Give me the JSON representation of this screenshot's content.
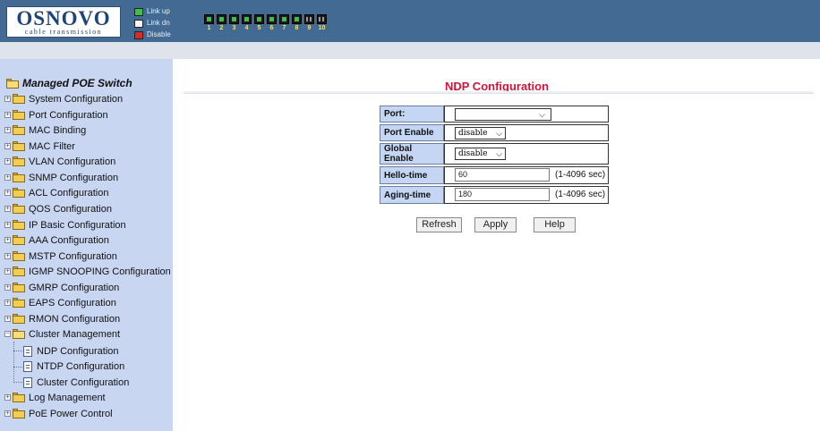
{
  "header": {
    "brand": "OSNOVO",
    "tagline": "cable transmission",
    "legend": [
      {
        "label": "Link up",
        "color": "#3ac14a"
      },
      {
        "label": "Link dn",
        "color": "#f5f5f5"
      },
      {
        "label": "Disable",
        "color": "#d92a2a"
      }
    ],
    "ports": [
      "1",
      "2",
      "3",
      "4",
      "5",
      "6",
      "7",
      "8",
      "9",
      "10"
    ]
  },
  "sidebar": {
    "title": "Managed POE Switch",
    "items": [
      {
        "label": "System Configuration"
      },
      {
        "label": "Port Configuration"
      },
      {
        "label": "MAC Binding"
      },
      {
        "label": "MAC Filter"
      },
      {
        "label": "VLAN Configuration"
      },
      {
        "label": "SNMP Configuration"
      },
      {
        "label": "ACL Configuration"
      },
      {
        "label": "QOS Configuration"
      },
      {
        "label": "IP Basic Configuration"
      },
      {
        "label": "AAA Configuration"
      },
      {
        "label": "MSTP Configuration"
      },
      {
        "label": "IGMP SNOOPING Configuration"
      },
      {
        "label": "GMRP Configuration"
      },
      {
        "label": "EAPS Configuration"
      },
      {
        "label": "RMON Configuration"
      },
      {
        "label": "Cluster Management"
      }
    ],
    "cluster_children": [
      {
        "label": "NDP Configuration"
      },
      {
        "label": "NTDP Configuration"
      },
      {
        "label": "Cluster Configuration"
      }
    ],
    "tail_items": [
      {
        "label": "Log Management"
      },
      {
        "label": "PoE Power Control"
      }
    ]
  },
  "main": {
    "title": "NDP Configuration",
    "fields": {
      "port_label": "Port:",
      "port_value": "",
      "port_enable_label": "Port Enable",
      "port_enable_value": "disable",
      "global_enable_label": "Global Enable",
      "global_enable_value": "disable",
      "hello_time_label": "Hello-time",
      "hello_time_value": "60",
      "hello_time_unit": "(1-4096 sec)",
      "aging_time_label": "Aging-time",
      "aging_time_value": "180",
      "aging_time_unit": "(1-4096 sec)"
    },
    "buttons": {
      "refresh": "Refresh",
      "apply": "Apply",
      "help": "Help"
    }
  }
}
